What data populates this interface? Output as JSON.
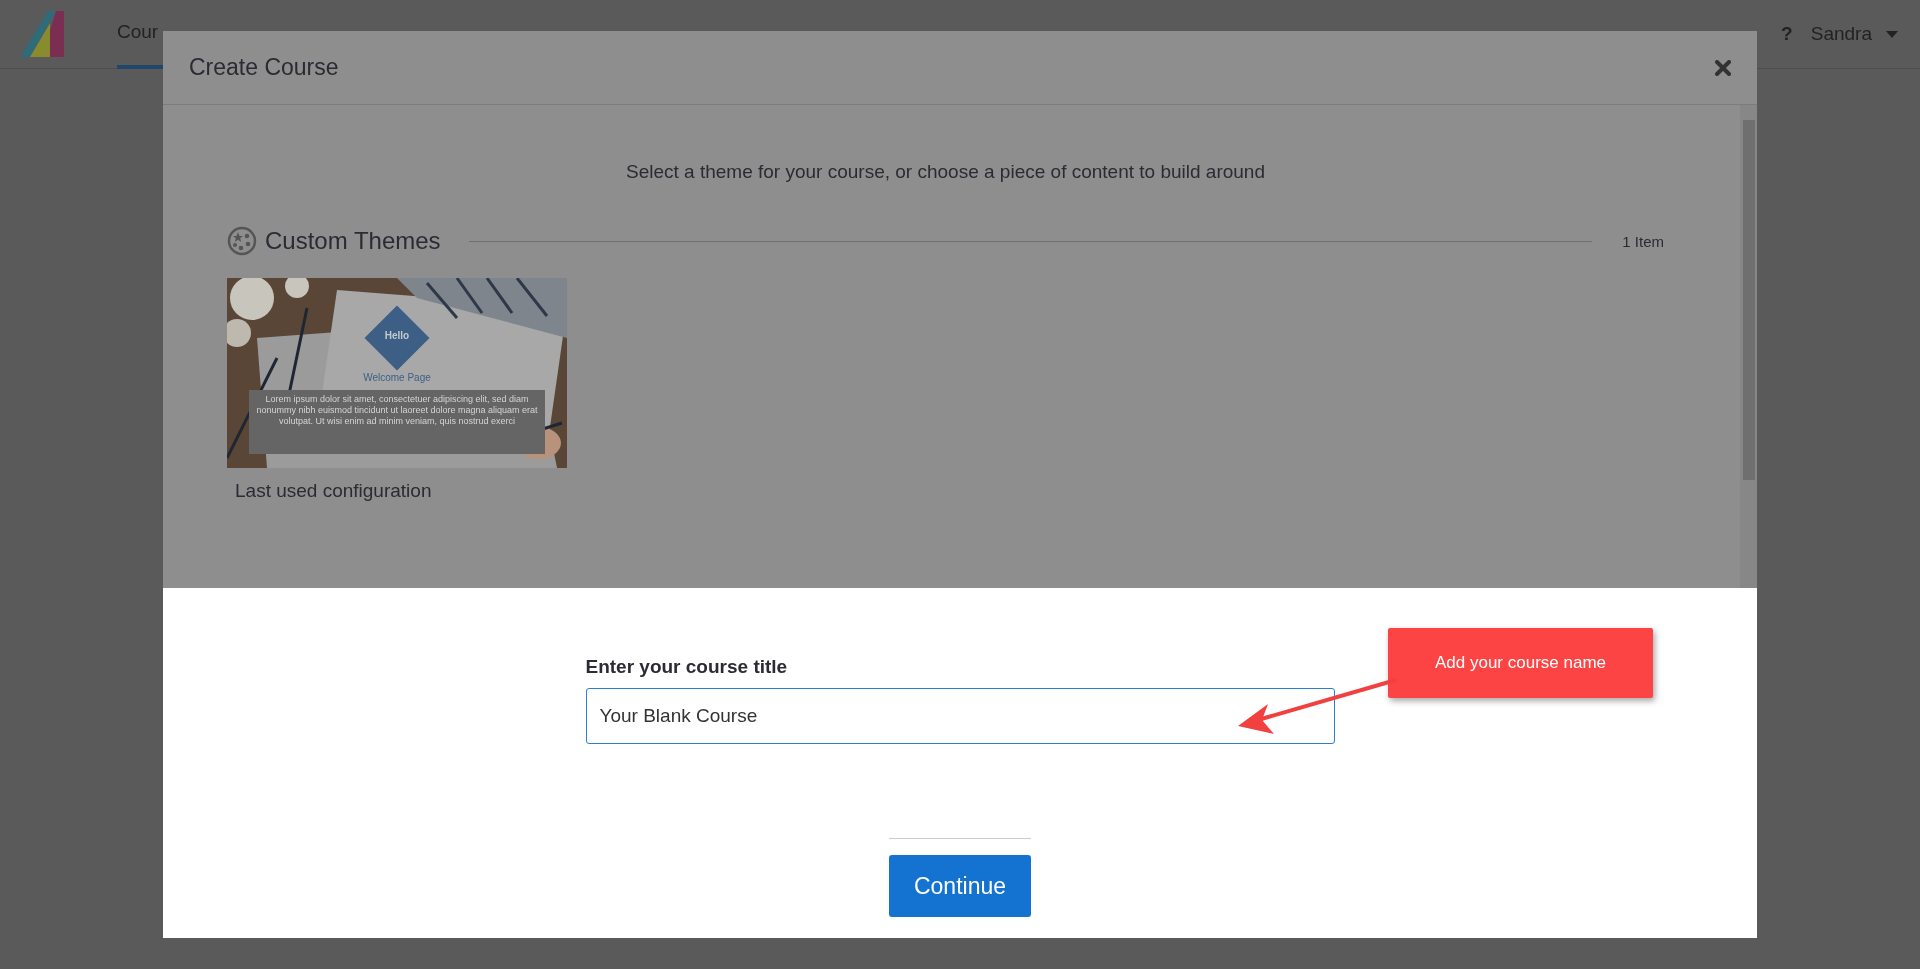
{
  "nav": {
    "tabs": [
      {
        "label": "Cour",
        "selected": true
      }
    ],
    "help": "?",
    "user": "Sandra"
  },
  "modal": {
    "title": "Create Course",
    "intro": "Select a theme for your course, or choose a piece of content to build around",
    "sections": [
      {
        "title": "Custom Themes",
        "count": "1 Item",
        "themes": [
          {
            "caption": "Last used configuration",
            "badge": "Hello",
            "heading": "Welcome Page",
            "body": "Lorem ipsum dolor sit amet, consectetuer adipiscing elit, sed diam nonummy nibh euismod tincidunt ut laoreet dolore magna aliquam erat volutpat. Ut wisi enim ad minim veniam, quis nostrud exerci"
          }
        ]
      }
    ],
    "form": {
      "label": "Enter your course title",
      "value": "Your Blank Course"
    },
    "callout": "Add your course name",
    "continue": "Continue"
  }
}
